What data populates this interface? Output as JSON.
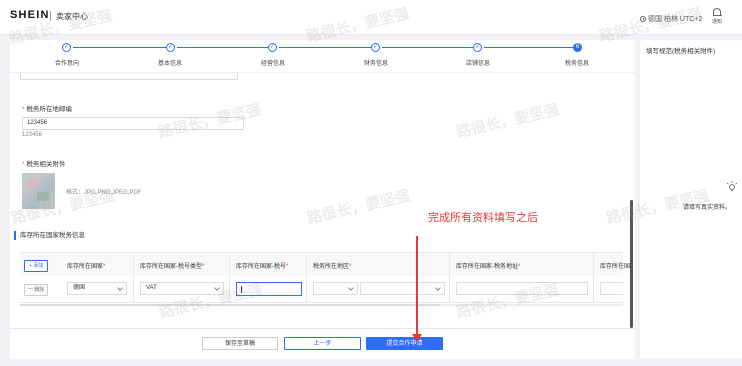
{
  "header": {
    "brand": "SHEIN",
    "center_name": "卖家中心",
    "timezone": "德国 柏林 UTC+2",
    "notice_label": "通知"
  },
  "steps": [
    {
      "label": "合作意向",
      "status": "done"
    },
    {
      "label": "基本信息",
      "status": "done"
    },
    {
      "label": "经营信息",
      "status": "done"
    },
    {
      "label": "财务信息",
      "status": "done"
    },
    {
      "label": "店铺信息",
      "status": "done"
    },
    {
      "label": "税务信息",
      "status": "current",
      "number": "6"
    }
  ],
  "form": {
    "postal_label": "税务所在地邮编",
    "postal_value": "123456",
    "postal_echo": "123456",
    "attach_label": "税务相关附件",
    "attach_formats": "格式：JPG,PNG,JPEG,PDF",
    "section_title": "库存所在国家税务信息"
  },
  "table": {
    "add_label": "+ 添加",
    "delete_label": "一 删除",
    "headers": [
      "库存所在国家",
      "库存所在国家-税号类型",
      "库存所在国家-税号",
      "税务所在地区",
      "库存所在国家-税务地址",
      "库存所在国"
    ],
    "row": {
      "country": "德国",
      "tax_type": "VAT",
      "tax_number": "",
      "region": "",
      "region2": ""
    }
  },
  "footer": {
    "save_draft": "保存至草稿",
    "prev": "上一步",
    "submit": "提交合作申请"
  },
  "side": {
    "title": "填写规范(税务相关附件)",
    "tip": "请填写真实资料。"
  },
  "annotation": {
    "text": "完成所有资料填写之后",
    "color": "#e53935"
  },
  "watermark": "路很长，要坚强",
  "colors": {
    "primary": "#2f6df5",
    "required": "#e54545"
  }
}
